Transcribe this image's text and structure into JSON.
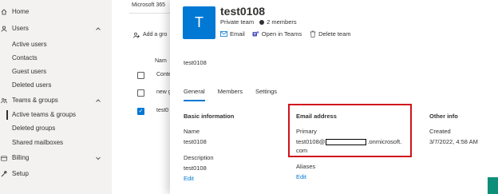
{
  "nav": {
    "items": [
      {
        "label": "Home",
        "icon": "home-icon",
        "expandable": false
      },
      {
        "label": "Users",
        "icon": "user-icon",
        "expandable": true
      },
      {
        "label": "Active users",
        "sub": true
      },
      {
        "label": "Contacts",
        "sub": true
      },
      {
        "label": "Guest users",
        "sub": true
      },
      {
        "label": "Deleted users",
        "sub": true
      },
      {
        "label": "Teams & groups",
        "icon": "group-icon",
        "expandable": true
      },
      {
        "label": "Active teams & groups",
        "sub": true,
        "selected": true
      },
      {
        "label": "Deleted groups",
        "sub": true
      },
      {
        "label": "Shared mailboxes",
        "sub": true
      },
      {
        "label": "Billing",
        "icon": "billing-icon",
        "expandable": true
      },
      {
        "label": "Setup",
        "icon": "setup-icon",
        "expandable": false
      }
    ]
  },
  "background": {
    "tab": "Microsoft 365",
    "add": "Add a gro",
    "column_header": "Nam",
    "rows": [
      {
        "name": "Conte",
        "checked": false
      },
      {
        "name": "new g",
        "checked": false
      },
      {
        "name": "test0",
        "checked": true
      }
    ]
  },
  "panel": {
    "avatar_letter": "T",
    "title": "test0108",
    "privacy": "Private team",
    "members": "2 members",
    "actions": {
      "email": "Email",
      "teams": "Open in Teams",
      "delete": "Delete team"
    },
    "description": "test0108",
    "tabs": [
      "General",
      "Members",
      "Settings"
    ],
    "basic": {
      "heading": "Basic information",
      "name_label": "Name",
      "name_value": "test0108",
      "desc_label": "Description",
      "desc_value": "test0108",
      "edit": "Edit"
    },
    "email": {
      "heading": "Email address",
      "primary_label": "Primary",
      "primary_prefix": "test0108@",
      "primary_suffix": ".onmicrosoft.",
      "primary_line2": "com",
      "aliases_label": "Aliases",
      "edit": "Edit"
    },
    "other": {
      "heading": "Other info",
      "created_label": "Created",
      "created_value": "3/7/2022, 4:58 AM"
    }
  },
  "colors": {
    "accent": "#0078d4",
    "highlight": "#d1121b",
    "nav_bg": "#f3f2f1"
  }
}
